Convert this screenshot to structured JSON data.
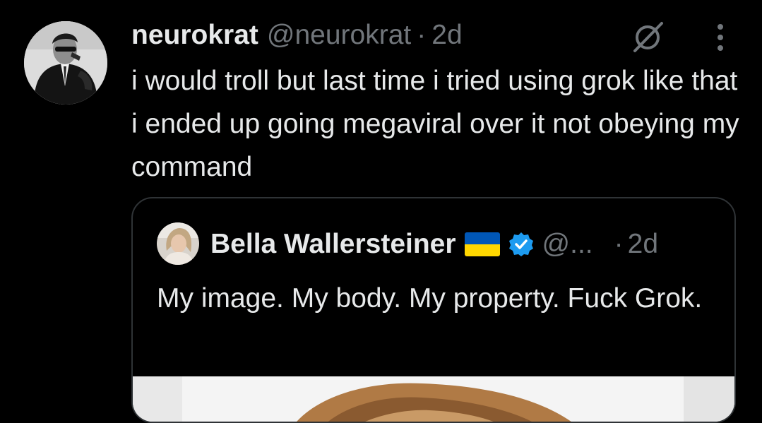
{
  "tweet": {
    "display_name": "neurokrat",
    "handle": "@neurokrat",
    "separator": "·",
    "time": "2d",
    "text": "i would troll but last time i tried using grok like that i ended up going megaviral over it not obeying my command",
    "icons": {
      "avatar": "profile-photo",
      "grok": "grok-icon",
      "more": "more-vertical-icon"
    }
  },
  "quote": {
    "display_name": "Bella Wallersteiner",
    "handle": "@...",
    "separator": "·",
    "time": "2d",
    "text": "My image. My body. My property. Fuck Grok.",
    "icons": {
      "avatar": "profile-photo",
      "flag": "ukraine-flag-icon",
      "verified": "verified-badge-icon",
      "media": "attached-photo"
    }
  },
  "colors": {
    "background": "#000000",
    "primary_text": "#e7e9ea",
    "secondary_text": "#71767b",
    "border": "#2f3336",
    "verified": "#1d9bf0",
    "flag_blue": "#0057b7",
    "flag_yellow": "#ffd700"
  }
}
